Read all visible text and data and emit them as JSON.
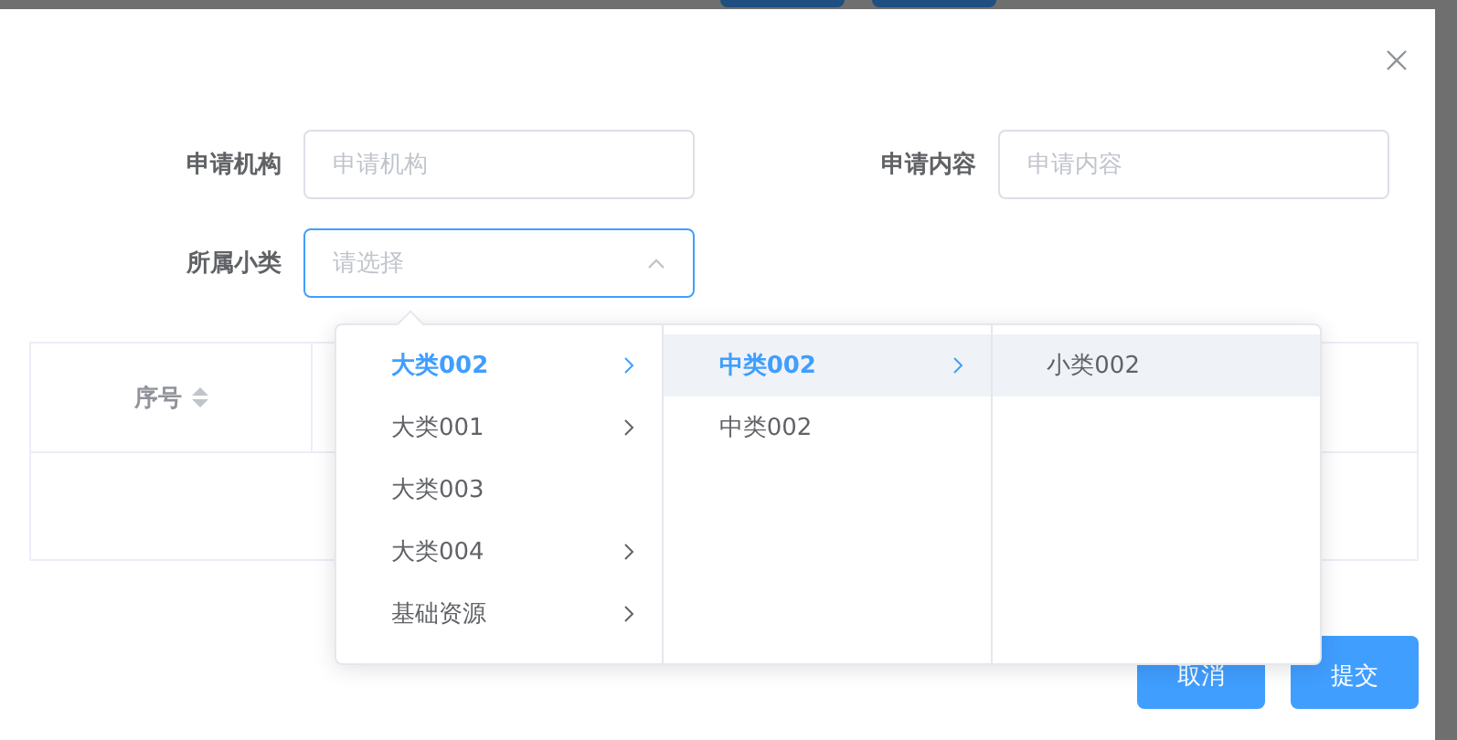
{
  "form": {
    "fields": [
      {
        "label": "申请机构",
        "placeholder": "申请机构",
        "kind": "input",
        "focused": false
      },
      {
        "label": "申请内容",
        "placeholder": "申请内容",
        "kind": "input",
        "focused": false
      },
      {
        "label": "所属小类",
        "placeholder": "请选择",
        "kind": "select",
        "focused": true
      }
    ]
  },
  "table": {
    "columns": [
      {
        "label": "序号",
        "sortable": true
      }
    ]
  },
  "cascader": {
    "columns": [
      {
        "items": [
          {
            "label": "大类002",
            "selected": true,
            "highlighted": false,
            "has_children": true
          },
          {
            "label": "大类001",
            "selected": false,
            "highlighted": false,
            "has_children": true
          },
          {
            "label": "大类003",
            "selected": false,
            "highlighted": false,
            "has_children": false
          },
          {
            "label": "大类004",
            "selected": false,
            "highlighted": false,
            "has_children": true
          },
          {
            "label": "基础资源",
            "selected": false,
            "highlighted": false,
            "has_children": true
          }
        ]
      },
      {
        "items": [
          {
            "label": "中类002",
            "selected": true,
            "highlighted": true,
            "has_children": true
          },
          {
            "label": "中类002",
            "selected": false,
            "highlighted": false,
            "has_children": false
          }
        ]
      },
      {
        "items": [
          {
            "label": "小类002",
            "selected": false,
            "highlighted": true,
            "has_children": false
          }
        ]
      }
    ]
  },
  "buttons": [
    {
      "label": "取消",
      "kind": "primary"
    },
    {
      "label": "提交",
      "kind": "primary"
    }
  ]
}
